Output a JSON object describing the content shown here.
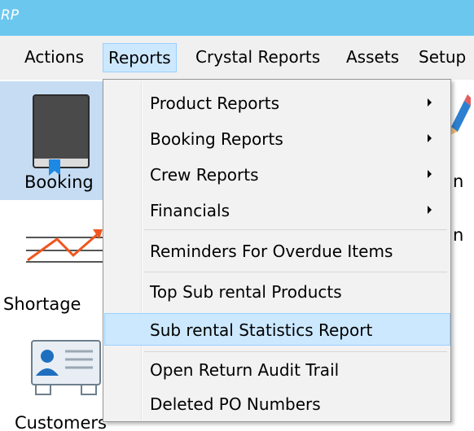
{
  "window": {
    "title": "RP"
  },
  "menubar": {
    "items": [
      "Actions",
      "Reports",
      "Crystal Reports",
      "Assets",
      "Setup"
    ]
  },
  "ribbon": {
    "booking_label": "Booking",
    "shortages_label": "Shortage",
    "customers_label": "Customers",
    "right_fragments": [
      "n",
      "n"
    ]
  },
  "reports_menu": {
    "items": [
      {
        "label": "Product Reports"
      },
      {
        "label": "Booking Reports"
      },
      {
        "label": "Crew Reports"
      },
      {
        "label": "Financials"
      },
      {
        "label": "Reminders For Overdue Items"
      },
      {
        "label": "Top Sub rental Products"
      },
      {
        "label": "Sub rental Statistics Report"
      },
      {
        "label": "Open Return Audit Trail"
      },
      {
        "label": "Deleted PO Numbers"
      }
    ]
  },
  "colors": {
    "titlebar": "#6cc7ef",
    "highlight": "#cce8ff",
    "highlight_border": "#99d1ff",
    "ribbon_selected": "#c5dcf3"
  }
}
